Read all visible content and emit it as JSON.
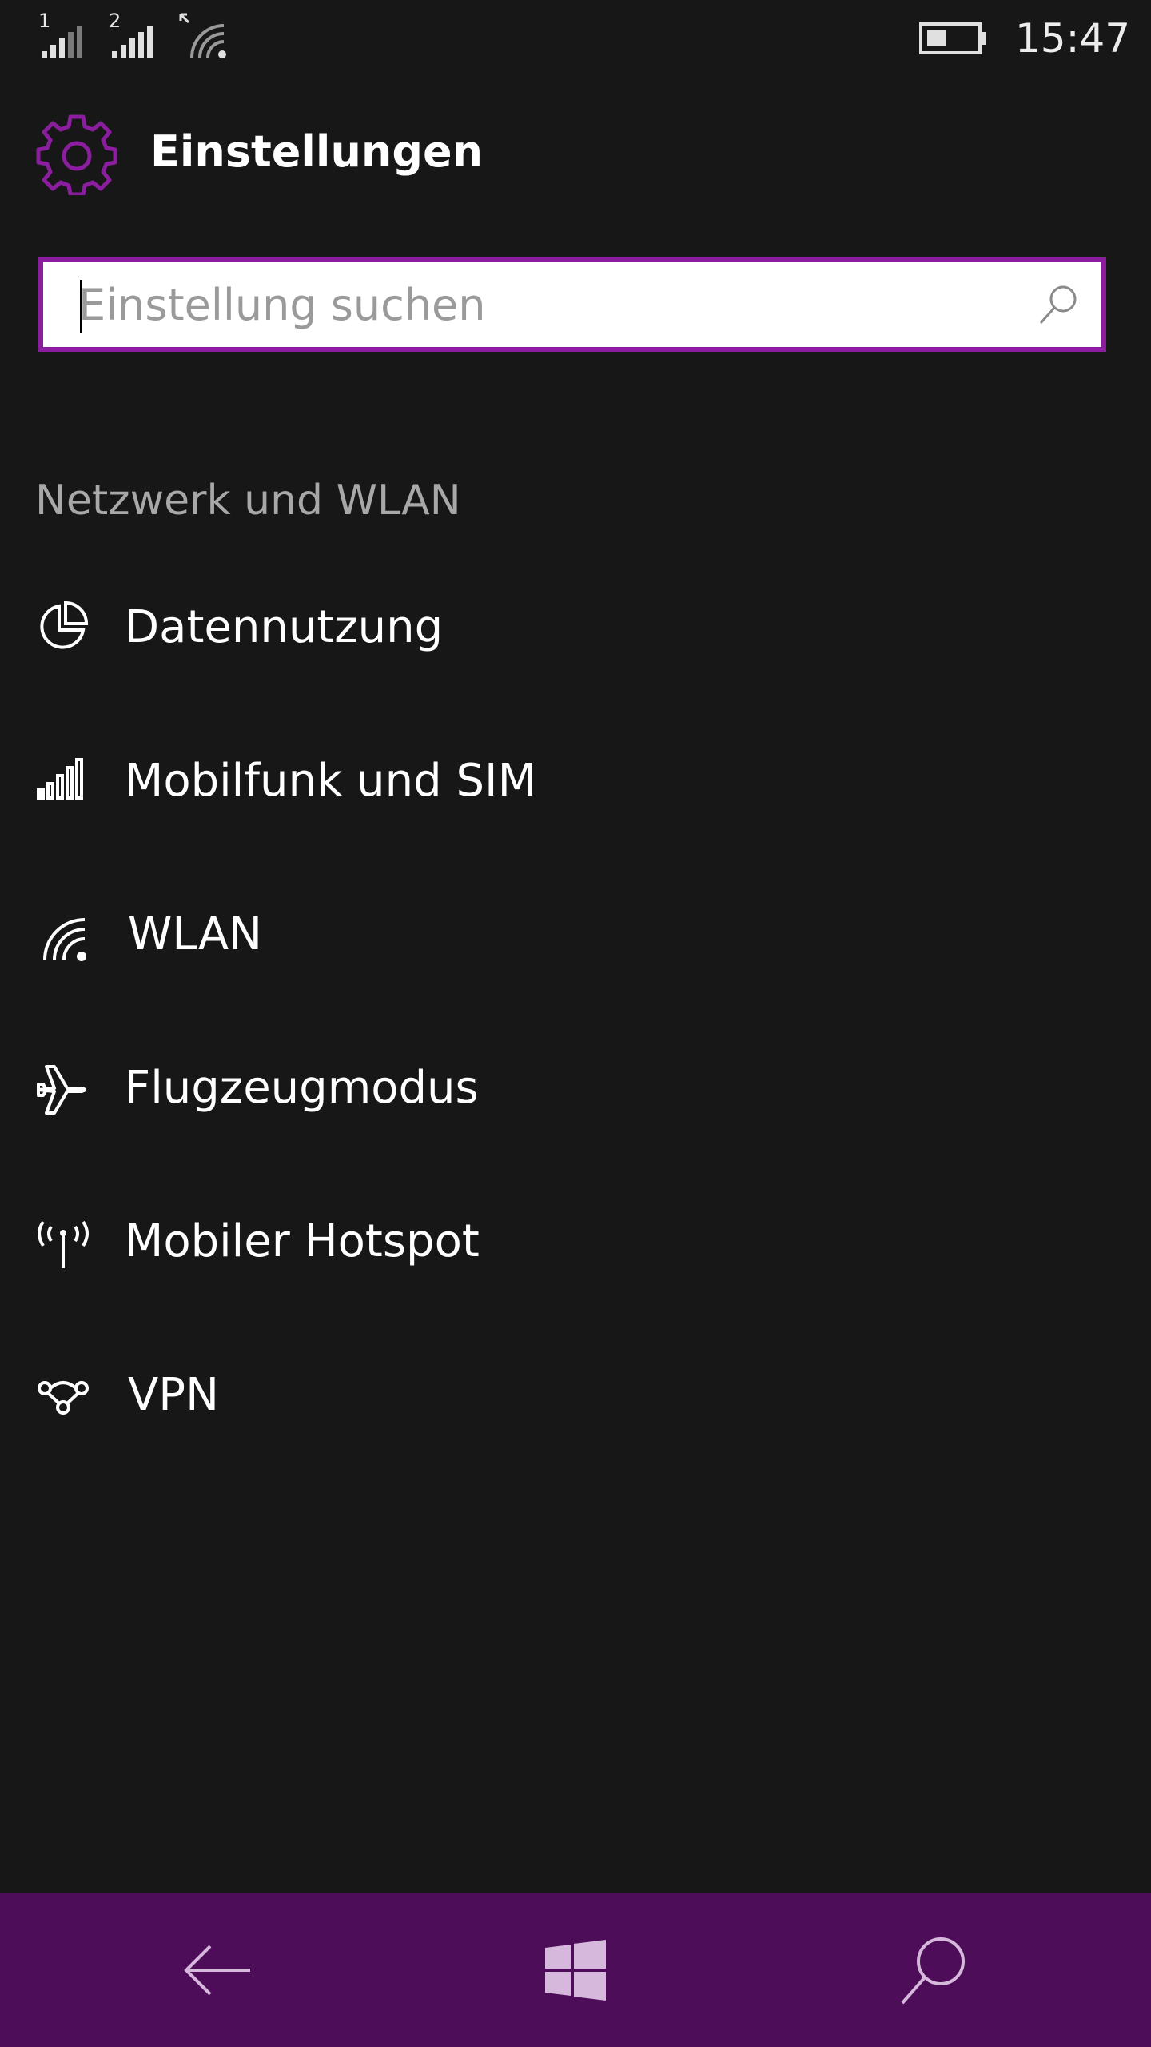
{
  "status_bar": {
    "sim1_label": "1",
    "sim2_label": "2",
    "time": "15:47",
    "icons": [
      "signal-sim1-icon",
      "signal-sim2-icon",
      "wifi-icon",
      "battery-icon"
    ]
  },
  "header": {
    "title": "Einstellungen",
    "icon": "gear-icon"
  },
  "search": {
    "placeholder": "Einstellung suchen",
    "icon": "search-icon"
  },
  "section": {
    "title": "Netzwerk und WLAN"
  },
  "items": [
    {
      "label": "Datennutzung",
      "icon": "pie-chart-icon"
    },
    {
      "label": "Mobilfunk und SIM",
      "icon": "cellular-signal-icon"
    },
    {
      "label": "WLAN",
      "icon": "wifi-icon"
    },
    {
      "label": "Flugzeugmodus",
      "icon": "airplane-icon"
    },
    {
      "label": "Mobiler Hotspot",
      "icon": "hotspot-icon"
    },
    {
      "label": "VPN",
      "icon": "vpn-icon"
    }
  ],
  "navbar": {
    "buttons": [
      "back-arrow-icon",
      "windows-logo-icon",
      "search-icon"
    ]
  },
  "colors": {
    "background": "#171717",
    "accent": "#8a1e9e",
    "navbar": "#4e0d59"
  }
}
